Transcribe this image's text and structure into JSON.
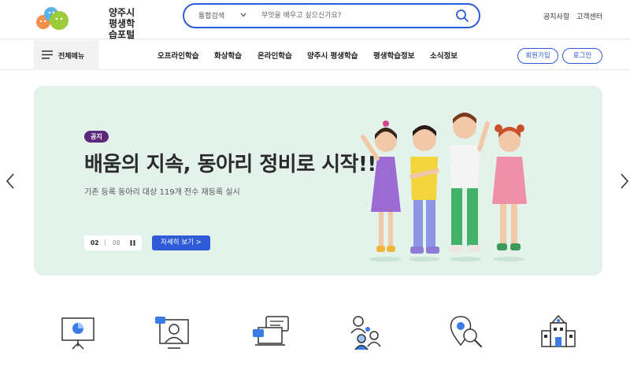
{
  "header": {
    "logo_line1": "양주시",
    "logo_line2": "평생학습포털",
    "search": {
      "category": "통합검색",
      "placeholder": "무엇을 배우고 싶으신가요?"
    },
    "utility_links": [
      "공지사항",
      "고객센터"
    ]
  },
  "nav": {
    "all_menu_label": "전체메뉴",
    "items": [
      "오프라인학습",
      "화상학습",
      "온라인학습",
      "양주시 평생학습",
      "평생학습정보",
      "소식정보"
    ],
    "signup_label": "회원가입",
    "login_label": "로그인"
  },
  "hero": {
    "badge": "공지",
    "title": "배움의 지속, 동아리 정비로 시작!!",
    "subtitle": "기존 등록 동아리 대상 119개 전수 재등록 실시",
    "pager_current": "02",
    "pager_separator": "|",
    "pager_total": "08",
    "detail_button": "자세히 보기  >"
  },
  "colors": {
    "brand_blue": "#2f5bd8",
    "hero_bg": "#e3f3ec",
    "badge_bg": "#5a2a7a"
  },
  "quick_icons": [
    "presentation-board-icon",
    "video-lecture-icon",
    "online-chat-icon",
    "community-people-icon",
    "search-location-icon",
    "school-building-icon"
  ]
}
